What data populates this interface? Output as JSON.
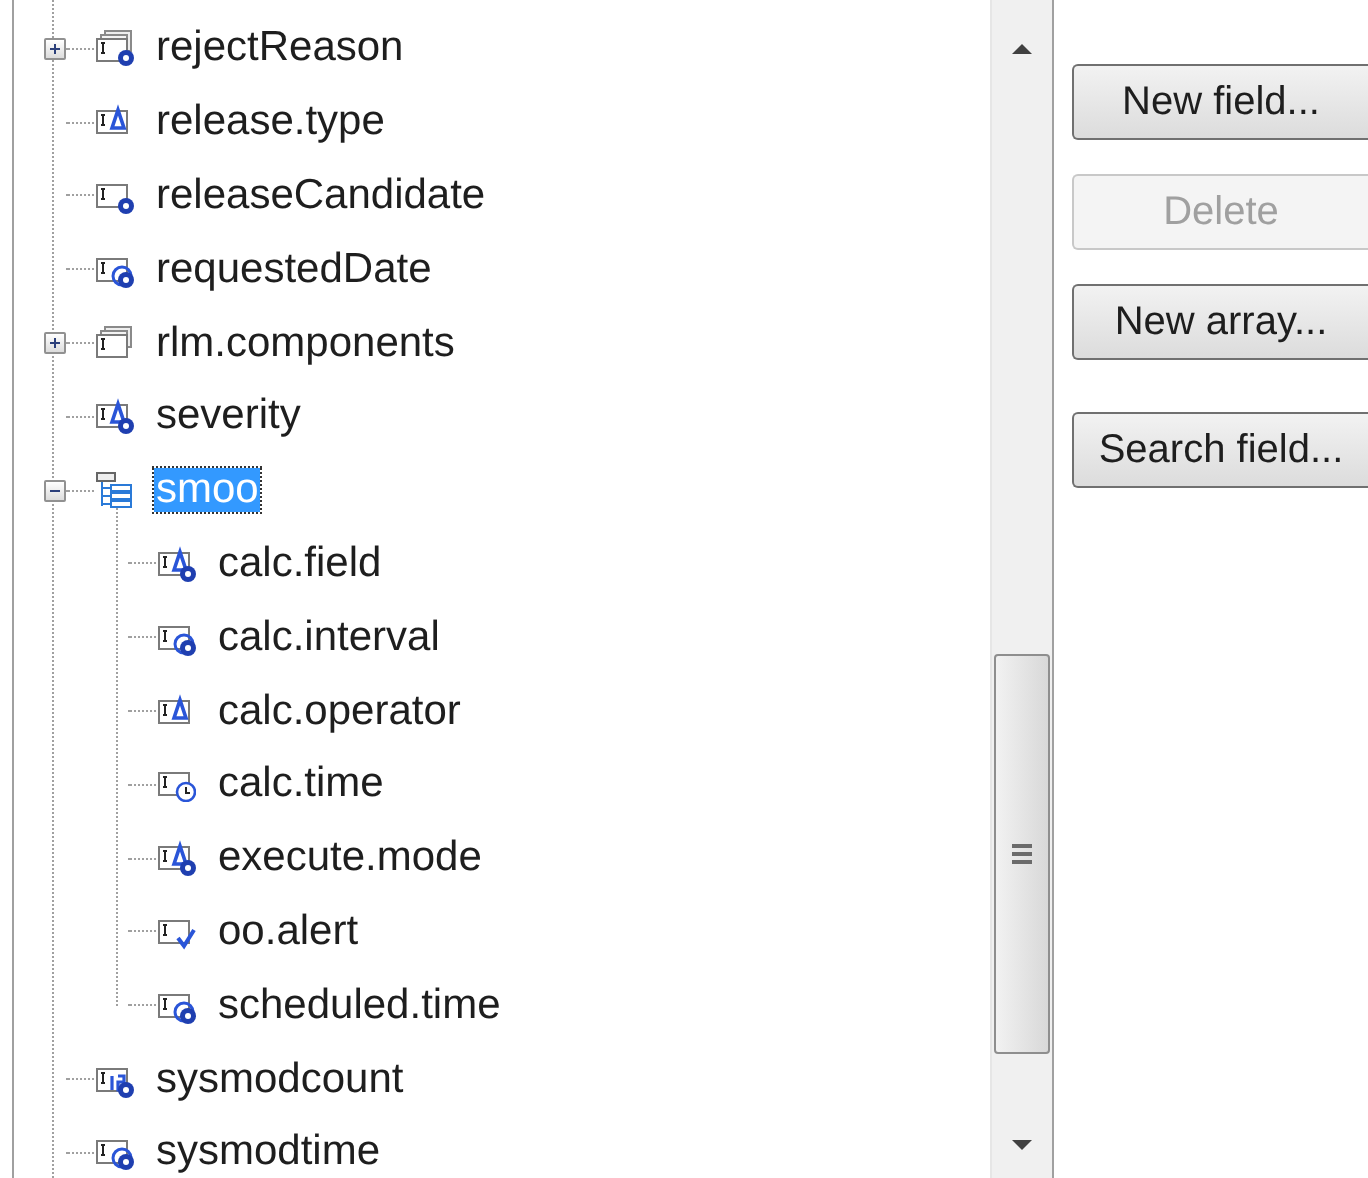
{
  "tree": {
    "items": [
      {
        "label": "rejectReason",
        "kind": "array-unknown",
        "expanded": false,
        "selected": false
      },
      {
        "label": "release.type",
        "kind": "text",
        "selected": false
      },
      {
        "label": "releaseCandidate",
        "kind": "unknown",
        "selected": false
      },
      {
        "label": "requestedDate",
        "kind": "date",
        "selected": false
      },
      {
        "label": "rlm.components",
        "kind": "array",
        "expanded": false,
        "selected": false
      },
      {
        "label": "severity",
        "kind": "text-unknown",
        "selected": false
      },
      {
        "label": "smoo",
        "kind": "structure",
        "expanded": true,
        "selected": true,
        "children": [
          {
            "label": "calc.field",
            "kind": "text-unknown",
            "selected": false
          },
          {
            "label": "calc.interval",
            "kind": "date",
            "selected": false
          },
          {
            "label": "calc.operator",
            "kind": "text",
            "selected": false
          },
          {
            "label": "calc.time",
            "kind": "time",
            "selected": false
          },
          {
            "label": "execute.mode",
            "kind": "text-unknown",
            "selected": false
          },
          {
            "label": "oo.alert",
            "kind": "boolean",
            "selected": false
          },
          {
            "label": "scheduled.time",
            "kind": "date",
            "selected": false
          }
        ]
      },
      {
        "label": "sysmodcount",
        "kind": "number",
        "selected": false
      },
      {
        "label": "sysmodtime",
        "kind": "date",
        "selected": false
      }
    ]
  },
  "buttons": [
    {
      "label": "New field...",
      "disabled": false
    },
    {
      "label": "Delete",
      "disabled": true
    },
    {
      "label": "New array...",
      "disabled": false
    },
    {
      "label": "Search field...",
      "disabled": false
    }
  ]
}
